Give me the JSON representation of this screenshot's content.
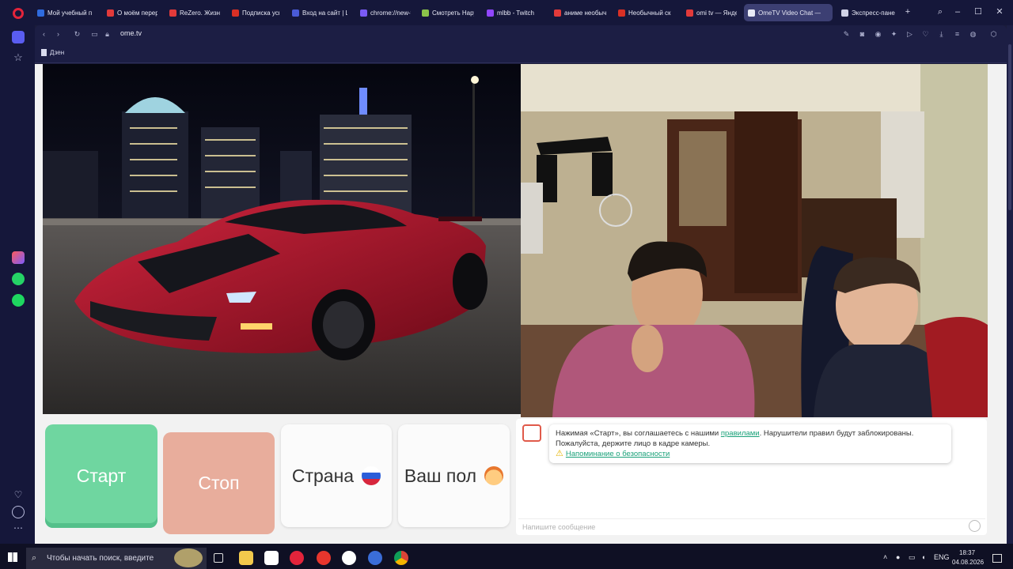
{
  "tabs": [
    {
      "title": "Мой учебный п",
      "fav": "#2f6bde"
    },
    {
      "title": "О моём перер",
      "fav": "#e23a3a"
    },
    {
      "title": "ReZero. Жизнь",
      "fav": "#e23a3a"
    },
    {
      "title": "Подписка успе",
      "fav": "#d93025"
    },
    {
      "title": "Вход на сайт | L",
      "fav": "#4a5bd6"
    },
    {
      "title": "chrome://new-t",
      "fav": "#7a5af5"
    },
    {
      "title": "Смотреть Нару",
      "fav": "#8bc34a"
    },
    {
      "title": "mlbb - Twitch",
      "fav": "#9146ff"
    },
    {
      "title": "аниме необыч",
      "fav": "#e23a3a"
    },
    {
      "title": "Необычный ск",
      "fav": "#d93025"
    },
    {
      "title": "omi tv — Яндекс",
      "fav": "#e23a3a"
    },
    {
      "title": "OmeTV Video Chat —",
      "fav": "#e8eaf5"
    },
    {
      "title": "Экспресс-пане",
      "fav": "#d0d2e6"
    }
  ],
  "address": {
    "url": "ome.tv"
  },
  "bookmarks": {
    "item": "Дзен"
  },
  "controls": {
    "start": "Старт",
    "stop": "Стоп",
    "country": "Страна",
    "gender": "Ваш пол"
  },
  "chat": {
    "notice_before": "Нажимая «Старт», вы соглашаетесь с нашими ",
    "notice_link": "правилами",
    "notice_after": ". Нарушители правил будут заблокированы.",
    "notice_line2": "Пожалуйста, держите лицо в кадре камеры.",
    "safety_link": "Напоминание о безопасности",
    "input_placeholder": "Напишите сообщение"
  },
  "taskbar": {
    "search_placeholder": "Чтобы начать поиск, введите",
    "lang": "ENG",
    "time": "18:37",
    "date": "04.08.2026"
  },
  "colors": {
    "start": "#6fd6a0",
    "stop": "#e8ad9c",
    "link": "#1aa179",
    "browser_bg": "#15173a"
  }
}
